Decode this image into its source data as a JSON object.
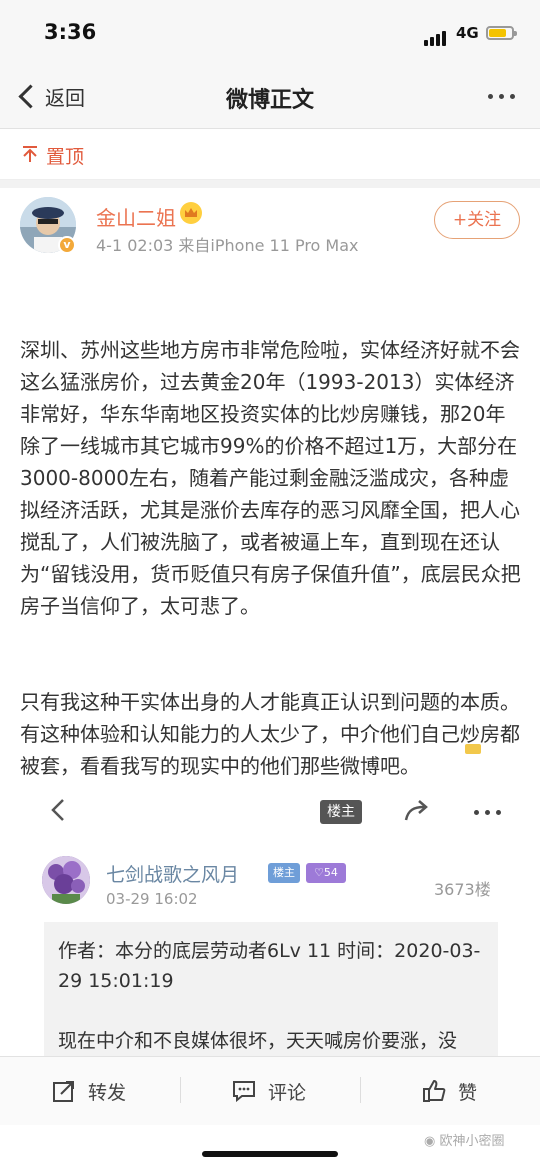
{
  "status_bar": {
    "time": "3:36",
    "network": "4G"
  },
  "nav": {
    "back_label": "返回",
    "title": "微博正文"
  },
  "pinned": {
    "label": "置顶"
  },
  "post": {
    "author": "金山二姐",
    "meta": "4-1 02:03  来自iPhone 11 Pro Max",
    "follow_label": "+关注",
    "paragraphs": [
      "深圳、苏州这些地方房市非常危险啦，实体经济好就不会这么猛涨房价，过去黄金20年（1993-2013）实体经济非常好，华东华南地区投资实体的比炒房赚钱，那20年除了一线城市其它城市99%的价格不超过1万，大部分在3000-8000左右，随着产能过剩金融泛滥成灾，各种虚拟经济活跃，尤其是涨价去库存的恶习风靡全国，把人心搅乱了，人们被洗脑了，或者被逼上车，直到现在还认为“留钱没用，货币贬值只有房子保值升值”，底层民众把房子当信仰了，太可悲了。",
      "只有我这种干实体出身的人才能真正认识到问题的本质。有这种体验和认知能力的人太少了，中介他们自己炒房都被套，看看我写的现实中的他们那些微博吧。"
    ]
  },
  "embedded": {
    "toolbar_tag": "楼主",
    "comment": {
      "name": "七剑战歌之风月",
      "tag_lz": "楼主",
      "tag_level": "♡54",
      "time": "03-29 16:02",
      "floor": "3673楼",
      "quote_lines": [
        "作者：本分的底层劳动者6Lv 11 时间：2020-03-29 15:01:19",
        "现在中介和不良媒体很坏，天天喊房价要涨，没"
      ]
    }
  },
  "bottom_bar": {
    "repost": "转发",
    "comment": "评论",
    "like": "赞"
  },
  "watermark": "欧神小密圈"
}
